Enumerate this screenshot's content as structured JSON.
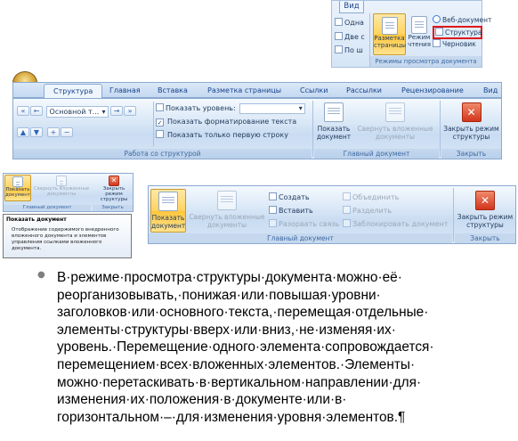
{
  "top_panel": {
    "tab": "Вид",
    "left_items": [
      "Одна",
      "Две с",
      "По ш"
    ],
    "page_layout": "Разметка страницы",
    "reading": "Режим чтения",
    "web": "Веб-документ",
    "structure": "Структура",
    "draft": "Черновик",
    "group": "Режимы просмотра документа"
  },
  "ribbon": {
    "tabs": [
      "Структура",
      "Главная",
      "Вставка",
      "Разметка страницы",
      "Ссылки",
      "Рассылки",
      "Рецензирование",
      "Вид"
    ],
    "level_value": "Основной т...",
    "show_level": "Показать уровень:",
    "show_format": "Показать форматирование текста",
    "first_line": "Показать только первую строку",
    "group_structure": "Работа со структурой",
    "show_doc": "Показать документ",
    "collapse": "Свернуть вложенные документы",
    "group_master": "Главный документ",
    "close_mode": "Закрыть режим структуры",
    "group_close": "Закрыть"
  },
  "mini": {
    "show_doc": "Показать документ",
    "collapse": "Свернуть вложенные документы",
    "close_mode": "Закрыть режим структуры",
    "group_master": "Главный документ",
    "group_close": "Закрыть",
    "tooltip_title": "Показать документ",
    "tooltip_text": "Отображение содержимого внедренного вложенного документа и элементов управления ссылками вложенного документа."
  },
  "expanded": {
    "show_doc": "Показать документ",
    "collapse": "Свернуть вложенные документы",
    "create": "Создать",
    "insert": "Вставить",
    "unlink": "Разорвать связь",
    "merge": "Объединить",
    "split": "Разделить",
    "lock": "Заблокировать документ",
    "group_master": "Главный документ",
    "close_mode": "Закрыть режим структуры",
    "group_close": "Закрыть"
  },
  "paragraph": {
    "bullet": "●",
    "lines": [
      "В·режиме·просмотра·структуры·документа·можно·её·",
      "реорганизовывать,·понижая·или·повышая·уровни·",
      "заголовков·или·основного·текста,·перемещая·отдельные·",
      "элементы·структуры·вверх·или·вниз,·не·изменяя·их·",
      "уровень.·Перемещение·одного·элемента·сопровождается·",
      "перемещением·всех·вложенных·элементов.·Элементы·",
      "можно·перетаскивать·в·вертикальном·направлении·для·",
      "изменения·их·положения·в·документе·или·в·",
      "горизонтальном·–·для·изменения·уровня·элементов.¶"
    ]
  }
}
